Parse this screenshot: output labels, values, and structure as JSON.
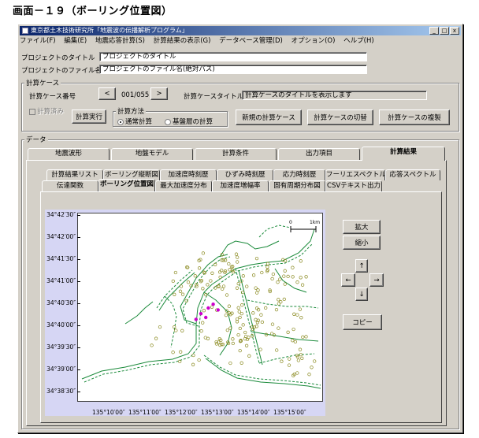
{
  "caption": "画面－１９（ボーリング位置図）",
  "window": {
    "title": "東京都土木技術研究所「地震波の伝播解析プログラム」",
    "controls": [
      "_",
      "□",
      "x"
    ]
  },
  "menu": [
    "ファイル(F)",
    "編集(E)",
    "地震応答計算(S)",
    "計算結果の表示(G)",
    "データベース管理(D)",
    "オプション(O)",
    "ヘルプ(H)"
  ],
  "project": {
    "title_label": "プロジェクトのタイトル",
    "title_value": "プロジェクトのタイトル",
    "file_label": "プロジェクトのファイル名",
    "file_value": "プロジェクトのファイル名(絶対パス)"
  },
  "calc_case": {
    "group_label": "計算ケース",
    "number_label": "計算ケース番号",
    "prev": "<",
    "number_value": "001/055",
    "next": ">",
    "case_title_label": "計算ケースタイトル",
    "case_title_value": "計算ケースのタイトルを表示します",
    "calc_done_label": "計算済み",
    "calc_exec": "計算実行",
    "method_label": "計算方法",
    "method_normal": "通常計算",
    "method_base": "基盤層の計算",
    "btn_new": "新規の計算ケース",
    "btn_switch": "計算ケースの切替",
    "btn_copy": "計算ケースの複製"
  },
  "data_label": "データ",
  "main_tabs": [
    "地震波形",
    "地盤モデル",
    "計算条件",
    "出力項目",
    "計算結果"
  ],
  "sub_tabs_row1": [
    "計算結果リスト",
    "ボーリング縦断図",
    "加速度時刻歴",
    "ひずみ時刻歴",
    "応力時刻歴",
    "フーリエスペクトル",
    "応答スペクトル"
  ],
  "sub_tabs_row2": [
    "伝達関数",
    "ボーリング位置図",
    "最大加速度分布",
    "加速度増幅率",
    "固有周期分布図",
    "CSVテキスト出力"
  ],
  "map": {
    "y_ticks": [
      "34°42′30″",
      "34°42′00″",
      "34°41′30″",
      "34°41′00″",
      "34°40′30″",
      "34°40′00″",
      "34°39′30″",
      "34°39′00″",
      "34°38′30″"
    ],
    "x_ticks": [
      "135°10′00″",
      "135°11′00″",
      "135°12′00″",
      "135°13′00″",
      "135°14′00″",
      "135°15′00″"
    ],
    "scale_start": "0",
    "scale_end": "1km",
    "coast_color": "#1a8a3a",
    "boring_color": "#8a8a20",
    "selected_color": "#cc00cc",
    "selected_points": [
      [
        0.5,
        0.53
      ],
      [
        0.53,
        0.5
      ],
      [
        0.55,
        0.48
      ],
      [
        0.57,
        0.51
      ],
      [
        0.52,
        0.55
      ],
      [
        0.48,
        0.56
      ]
    ]
  },
  "side_buttons": {
    "zoom_in": "拡大",
    "zoom_out": "縮小",
    "up": "↑",
    "left": "←",
    "right": "→",
    "down": "↓",
    "copy": "コピー"
  }
}
